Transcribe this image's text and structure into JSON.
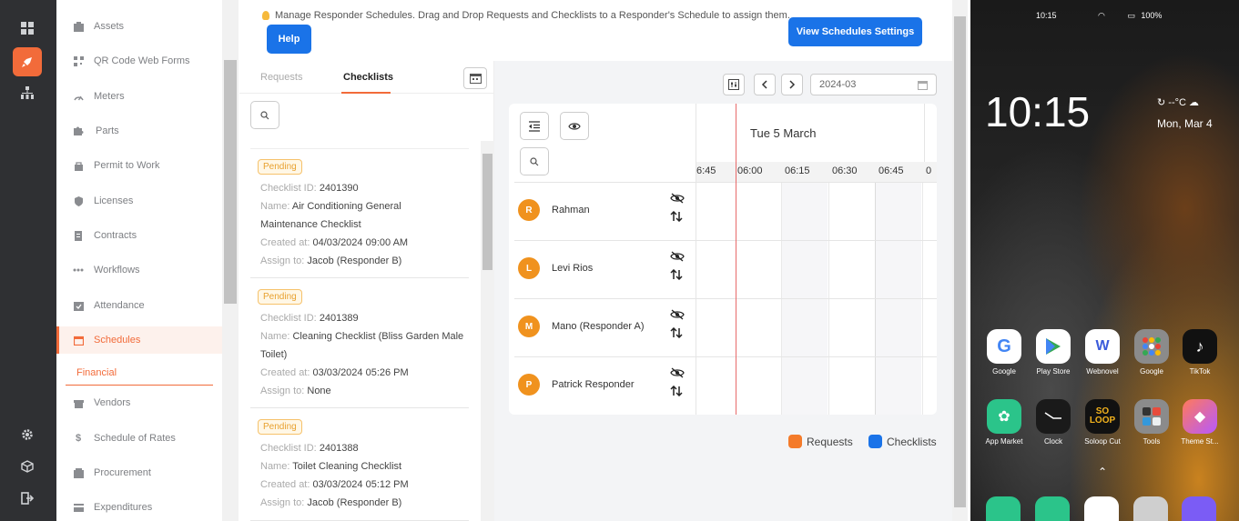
{
  "rail": {
    "items": [
      {
        "icon": "dashboard-icon"
      },
      {
        "icon": "rocket-icon",
        "active": true
      },
      {
        "icon": "hierarchy-icon"
      },
      {
        "icon": "gear-icon"
      },
      {
        "icon": "cube-icon"
      },
      {
        "icon": "logout-icon"
      }
    ]
  },
  "sidebar": {
    "items": [
      {
        "label": "Assets",
        "icon": "assets-icon"
      },
      {
        "label": "QR Code Web Forms",
        "icon": "qr-icon"
      },
      {
        "label": "Meters",
        "icon": "meter-icon"
      },
      {
        "label": "Parts",
        "icon": "puzzle-icon"
      },
      {
        "label": "Permit to Work",
        "icon": "permit-icon"
      },
      {
        "label": "Licenses",
        "icon": "shield-icon"
      },
      {
        "label": "Contracts",
        "icon": "contract-icon"
      },
      {
        "label": "Workflows",
        "icon": "workflow-icon"
      },
      {
        "label": "Attendance",
        "icon": "attendance-icon"
      },
      {
        "label": "Schedules",
        "icon": "calendar-icon",
        "active": true
      },
      {
        "label": "Vendors",
        "icon": "vendor-icon"
      },
      {
        "label": "Schedule of Rates",
        "icon": "dollar-icon"
      },
      {
        "label": "Procurement",
        "icon": "procurement-icon"
      },
      {
        "label": "Expenditures",
        "icon": "expenditure-icon"
      }
    ],
    "sub_active": "Financial"
  },
  "header": {
    "hint": "Manage Responder Schedules. Drag and Drop Requests and Checklists to a Responder's Schedule to assign them.",
    "help_label": "Help",
    "settings_label": "View Schedules Settings"
  },
  "tabs": [
    {
      "label": "Requests"
    },
    {
      "label": "Checklists",
      "active": true
    }
  ],
  "labels": {
    "checklist_id": "Checklist ID:",
    "name": "Name:",
    "created_at": "Created at:",
    "assign_to": "Assign to:"
  },
  "checklists": [
    {
      "status": "Pending",
      "id": "2401390",
      "name_line1": "Air Conditioning General",
      "name_line2": "Maintenance Checklist",
      "created": "04/03/2024 09:00 AM",
      "assign": "Jacob (Responder B)"
    },
    {
      "status": "Pending",
      "id": "2401389",
      "name_line1": "Cleaning Checklist (Bliss Garden Male",
      "name_line2": "Toilet)",
      "created": "03/03/2024 05:26 PM",
      "assign": "None"
    },
    {
      "status": "Pending",
      "id": "2401388",
      "name_line1": "Toilet Cleaning Checklist",
      "name_line2": "",
      "created": "03/03/2024 05:12 PM",
      "assign": "Jacob (Responder B)"
    }
  ],
  "schedule": {
    "month": "2024-03",
    "day_title": "Tue 5 March",
    "times": [
      "6:45",
      "06:00",
      "06:15",
      "06:30",
      "06:45",
      "0"
    ],
    "responders": [
      {
        "initial": "R",
        "name": "Rahman"
      },
      {
        "initial": "L",
        "name": "Levi Rios"
      },
      {
        "initial": "M",
        "name": "Mano (Responder A)"
      },
      {
        "initial": "P",
        "name": "Patrick Responder"
      }
    ]
  },
  "legend": [
    {
      "label": "Requests",
      "color": "#f47b2a"
    },
    {
      "label": "Checklists",
      "color": "#1a73e8"
    }
  ],
  "phone": {
    "status_time": "10:15",
    "battery": "100%",
    "clock": "10:15",
    "weather": "--°C",
    "date": "Mon, Mar 4",
    "apps_row1": [
      "Google",
      "Play Store",
      "Webnovel",
      "Google",
      "TikTok"
    ],
    "apps_row2": [
      "App Market",
      "Clock",
      "Soloop Cut",
      "Tools",
      "Theme St..."
    ],
    "soloop_mark": "SO LOOP"
  }
}
